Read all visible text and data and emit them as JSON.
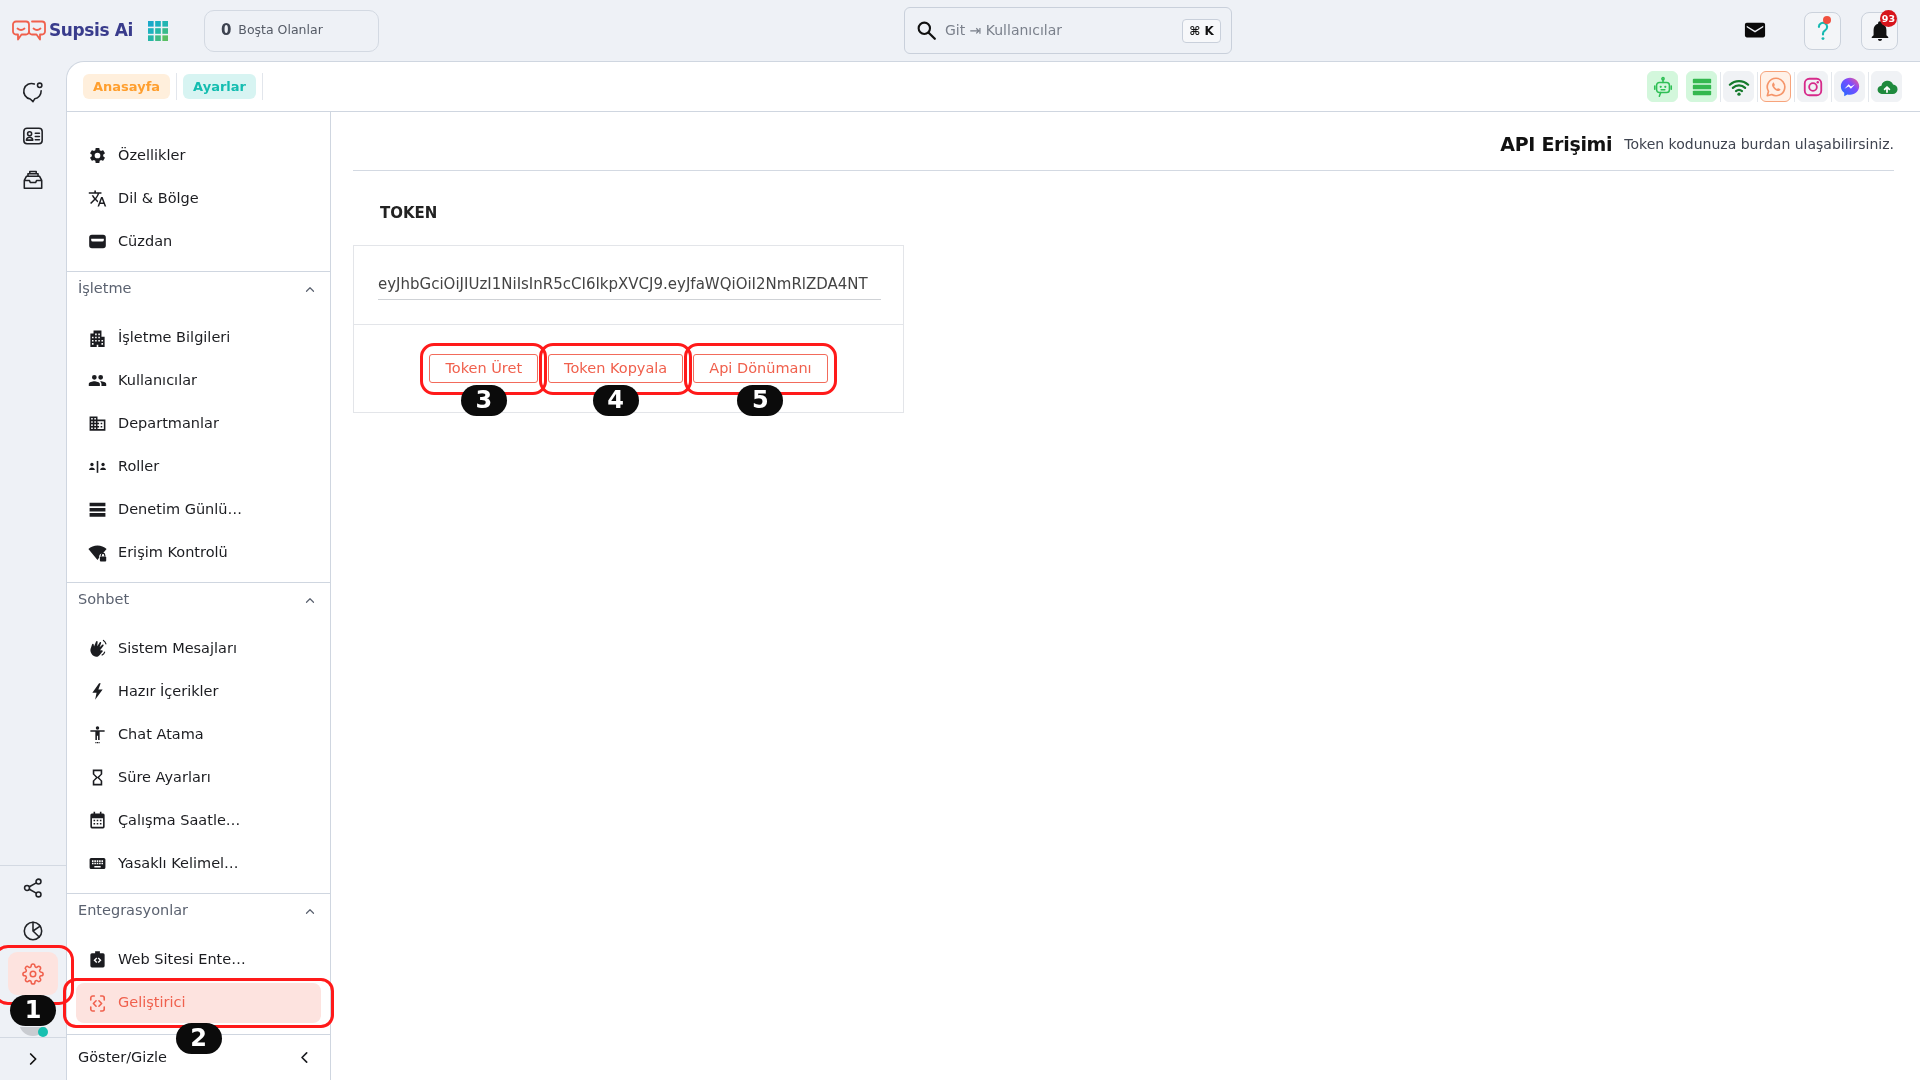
{
  "header": {
    "logo_text": "Supsis Ai",
    "idle_counter": {
      "count": "0",
      "label": "Boşta Olanlar"
    },
    "search": {
      "placeholder": "Git ⇥ Kullanıcılar",
      "shortcut": "⌘ K"
    },
    "help": {
      "unread": true
    },
    "notifications": {
      "count": "93"
    }
  },
  "rail": {
    "top_items": [
      {
        "selected": false
      },
      {
        "selected": false
      },
      {
        "selected": false
      }
    ],
    "bottom_items": [
      {
        "selected": false
      },
      {
        "selected": false
      },
      {
        "selected": true,
        "callout": "1"
      }
    ],
    "user": {
      "online": true
    }
  },
  "breadcrumbs": [
    {
      "label": "Anasayfa",
      "color": "#ff9f2f"
    },
    {
      "label": "Ayarlar",
      "color": "#14bdb0"
    }
  ],
  "channels": [
    {
      "connected": true,
      "alert": false
    },
    {
      "connected": true,
      "alert": false
    },
    {
      "connected": false,
      "alert": false
    },
    {
      "connected": false,
      "alert": true
    },
    {
      "connected": false,
      "alert": false
    },
    {
      "connected": false,
      "alert": false
    },
    {
      "connected": false,
      "alert": false
    }
  ],
  "settings_menu": {
    "groups": [
      {
        "items": [
          {
            "label": "Özellikler",
            "selected": false
          },
          {
            "label": "Dil & Bölge",
            "selected": false
          },
          {
            "label": "Cüzdan",
            "selected": false
          }
        ]
      },
      {
        "title": "İşletme",
        "expanded": true,
        "items": [
          {
            "label": "İşletme Bilgileri",
            "selected": false
          },
          {
            "label": "Kullanıcılar",
            "selected": false
          },
          {
            "label": "Departmanlar",
            "selected": false
          },
          {
            "label": "Roller",
            "selected": false
          },
          {
            "label": "Denetim Günlü…",
            "selected": false
          },
          {
            "label": "Erişim Kontrolü",
            "selected": false
          }
        ]
      },
      {
        "title": "Sohbet",
        "expanded": true,
        "items": [
          {
            "label": "Sistem Mesajları",
            "selected": false
          },
          {
            "label": "Hazır İçerikler",
            "selected": false
          },
          {
            "label": "Chat Atama",
            "selected": false
          },
          {
            "label": "Süre Ayarları",
            "selected": false
          },
          {
            "label": "Çalışma Saatle…",
            "selected": false
          },
          {
            "label": "Yasaklı Kelimel…",
            "selected": false
          }
        ]
      },
      {
        "title": "Entegrasyonlar",
        "expanded": true,
        "items": [
          {
            "label": "Web Sitesi Ente…",
            "selected": false
          },
          {
            "label": "Geliştirici",
            "selected": true,
            "callout": "2"
          }
        ]
      }
    ],
    "toggle_label": "Göster/Gizle"
  },
  "page": {
    "title": "API Erişimi",
    "subtitle": "Token kodunuza burdan ulaşabilirsiniz.",
    "token_label": "TOKEN",
    "token_value": "eyJhbGciOiJIUzI1NiIsInR5cCI6IkpXVCJ9.eyJfaWQiOiI2NmRlZDA4NT",
    "buttons": [
      {
        "label": "Token Üret",
        "callout": "3"
      },
      {
        "label": "Token Kopyala",
        "callout": "4"
      },
      {
        "label": "Api Dönümanı",
        "callout": "5"
      }
    ]
  }
}
